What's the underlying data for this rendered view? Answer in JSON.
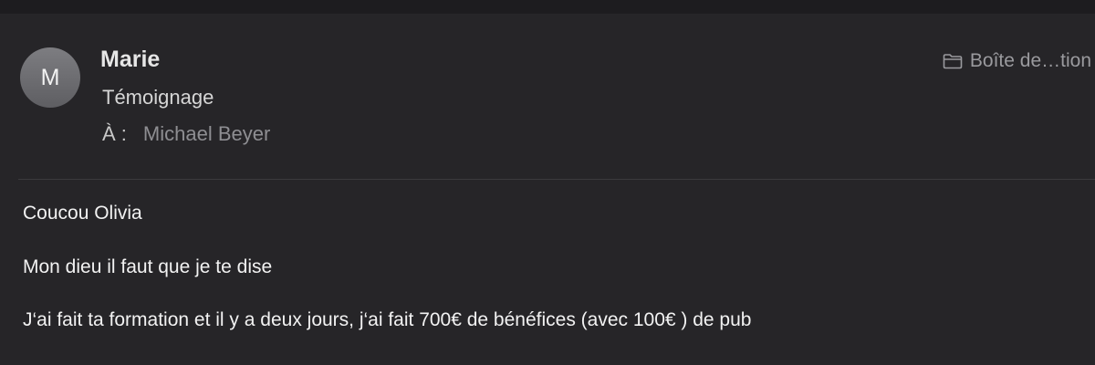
{
  "header": {
    "avatar_initial": "M",
    "sender": "Marie",
    "subject": "Témoignage",
    "to_label": "À :",
    "to_value": "Michael Beyer",
    "folder_label": "Boîte de…tion",
    "folder_icon": "folder-icon"
  },
  "message": {
    "lines": [
      "Coucou Olivia",
      "Mon dieu il faut que je te dise",
      "J‘ai fait ta formation et il y a deux jours, j‘ai fait 700€ de bénéfices (avec 100€ ) de pub"
    ]
  },
  "colors": {
    "background": "#262528",
    "topbar": "#1d1c1f",
    "avatar": "#6e6e72",
    "text_primary": "#f2f2f2",
    "text_secondary": "#8e8e92"
  }
}
